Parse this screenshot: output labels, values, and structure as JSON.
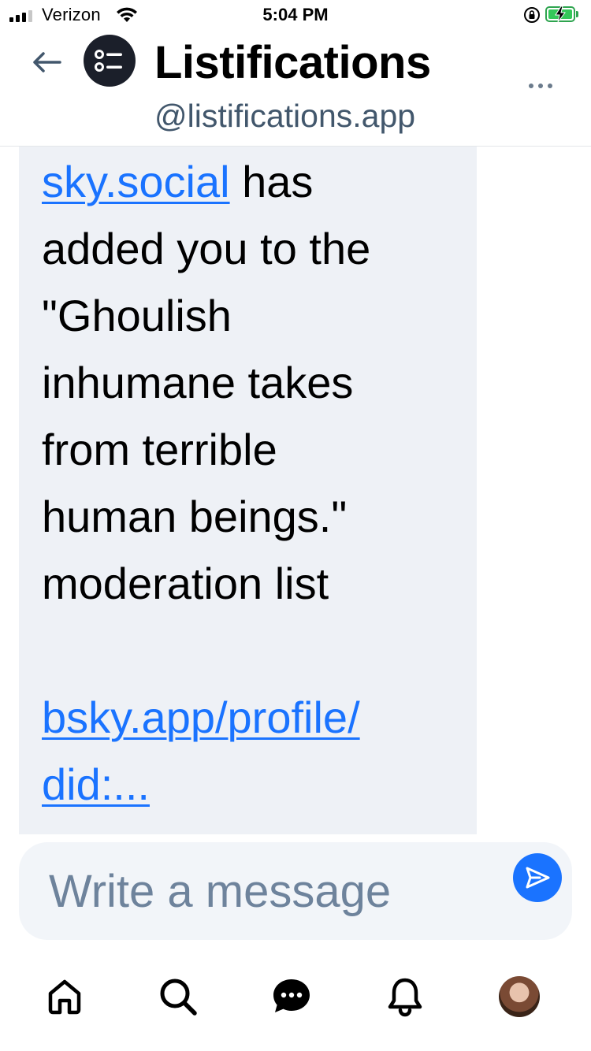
{
  "status_bar": {
    "carrier": "Verizon",
    "time": "5:04 PM"
  },
  "header": {
    "title": "Listifications",
    "handle": "@listifications.app"
  },
  "message": {
    "lines": [
      {
        "text": "sky.social",
        "link": true,
        "suffix": " has"
      },
      {
        "text": "added you to the"
      },
      {
        "text": "\"Ghoulish"
      },
      {
        "text": "inhumane takes"
      },
      {
        "text": "from terrible"
      },
      {
        "text": "human beings.\""
      },
      {
        "text": "moderation list"
      },
      {
        "text": ""
      },
      {
        "text": "bsky.app/profile/",
        "link": true
      },
      {
        "text": "did:...",
        "link": true
      }
    ]
  },
  "composer": {
    "placeholder": "Write a message"
  },
  "colors": {
    "accent": "#1a73ff",
    "bubble_bg": "#eef1f6",
    "handle_text": "#42576c",
    "placeholder_text": "#6e839c"
  },
  "icons": {
    "back": "arrow-left-icon",
    "logo": "list-icon",
    "more": "more-horizontal-icon",
    "send": "send-icon",
    "nav": [
      "home-icon",
      "search-icon",
      "chat-icon",
      "bell-icon",
      "profile-avatar"
    ]
  }
}
